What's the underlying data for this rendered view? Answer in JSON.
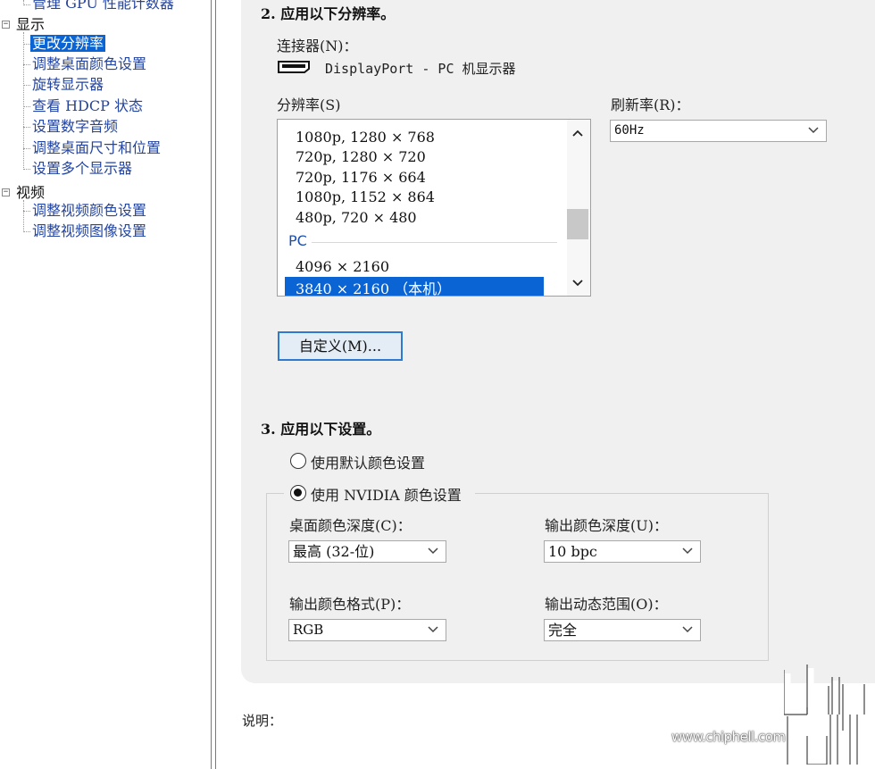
{
  "tree": {
    "top_item": "管理 GPU 性能计数器",
    "display_category": "显示",
    "display_items": [
      "更改分辨率",
      "调整桌面颜色设置",
      "旋转显示器",
      "查看 HDCP 状态",
      "设置数字音频",
      "调整桌面尺寸和位置",
      "设置多个显示器"
    ],
    "video_category": "视频",
    "video_items": [
      "调整视频颜色设置",
      "调整视频图像设置"
    ],
    "expander_glyph": "−"
  },
  "section2": {
    "heading": "2. 应用以下分辨率。",
    "connector_label": "连接器(N)：",
    "connector_value": "DisplayPort - PC 机显示器",
    "connector_icon": "displayport-icon",
    "resolution_label": "分辨率(S)",
    "refresh_label": "刷新率(R)：",
    "refresh_value": "60Hz",
    "resolutions": [
      "1080p, 1280 × 768",
      "720p, 1280 × 720",
      "720p, 1176 × 664",
      "1080p, 1152 × 864",
      "480p, 720 × 480"
    ],
    "group_pc": "PC",
    "pc_resolutions": [
      "4096 × 2160",
      "3840 × 2160 （本机）"
    ],
    "selected_index": 1,
    "customize_button": "自定义(M)..."
  },
  "section3": {
    "heading": "3. 应用以下设置。",
    "radio_default": "使用默认颜色设置",
    "radio_nvidia": "使用 NVIDIA 颜色设置",
    "radio_selected": "nvidia",
    "desktop_depth_label": "桌面颜色深度(C)：",
    "desktop_depth_value": "最高 (32-位)",
    "output_depth_label": "输出颜色深度(U)：",
    "output_depth_value": "10 bpc",
    "output_format_label": "输出颜色格式(P)：",
    "output_format_value": "RGB",
    "output_range_label": "输出动态范围(O)：",
    "output_range_value": "完全"
  },
  "description_label": "说明：",
  "watermark": {
    "site": "www.chiphell.com",
    "logo": "chiphell-logo"
  },
  "colors": {
    "selection": "#0a64d4",
    "link": "#2344a0",
    "panel_bg": "#f0f0f0",
    "button_border": "#2e7ad1"
  }
}
